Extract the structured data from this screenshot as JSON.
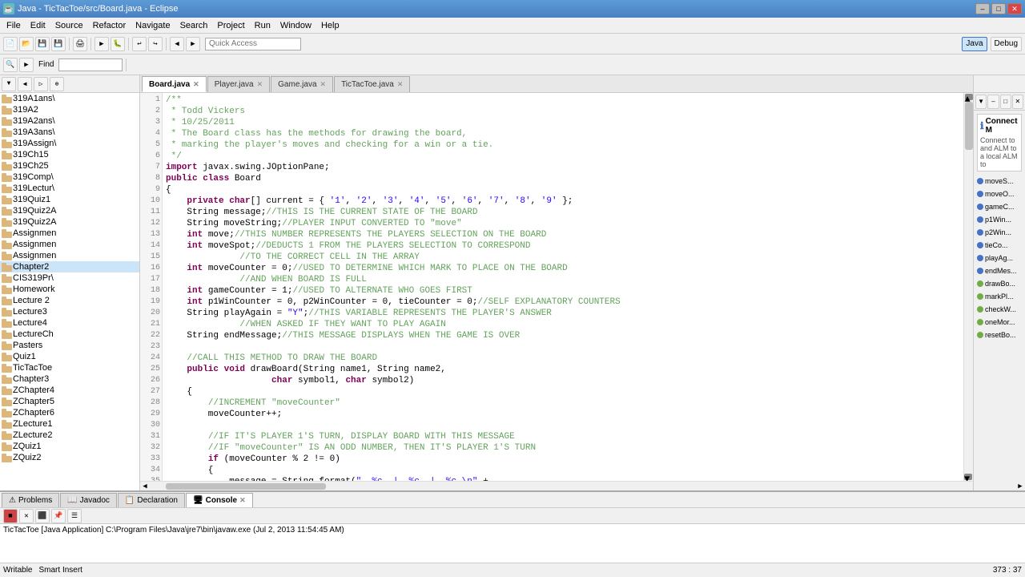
{
  "window": {
    "title": "Java - TicTacToe/src/Board.java - Eclipse",
    "icon": "☕"
  },
  "title_bar_buttons": {
    "minimize": "–",
    "maximize": "□",
    "close": "✕"
  },
  "menu": {
    "items": [
      "File",
      "Edit",
      "Source",
      "Refactor",
      "Navigate",
      "Search",
      "Project",
      "Run",
      "Window",
      "Help"
    ]
  },
  "toolbar": {
    "quick_access_placeholder": "Quick Access",
    "perspective_java": "Java",
    "perspective_debug": "Debug"
  },
  "editor_tabs": [
    {
      "label": "Board.java",
      "active": true
    },
    {
      "label": "Player.java",
      "active": false
    },
    {
      "label": "Game.java",
      "active": false
    },
    {
      "label": "TicTacToe.java",
      "active": false
    }
  ],
  "code": {
    "author": "Todd Vickers",
    "date": "10/25/2011",
    "comment1": "* The Board class has the methods for drawing the board,",
    "comment2": "* marking the player's moves and checking for a win or a tie.",
    "comment3": "*/",
    "import1": "import javax.swing.JOptionPane;",
    "class_decl": "public class Board",
    "lines": [
      "/**",
      " * Todd Vickers",
      " * 10/25/2011",
      " * The Board class has the methods for drawing the board,",
      " * marking the player's moves and checking for a win or a tie.",
      " */",
      "import javax.swing.JOptionPane;",
      "public class Board",
      "{",
      "    private char[] current = { '1', '2', '3', '4', '5', '6', '7', '8', '9' };",
      "    String message;//THIS IS THE CURRENT STATE OF THE BOARD",
      "    String moveString;//PLAYER INPUT CONVERTED TO \"move\"",
      "    int move;//THIS NUMBER REPRESENTS THE PLAYERS SELECTION ON THE BOARD",
      "    int moveSpot;//DEDUCTS 1 FROM THE PLAYERS SELECTION TO CORRESPOND",
      "                  //TO THE CORRECT CELL IN THE ARRAY",
      "    int moveCounter = 0;//USED TO DETERMINE WHICH MARK TO PLACE ON THE BOARD",
      "                  //AND WHEN BOARD IS FULL",
      "    int gameCounter = 1;//USED TO ALTERNATE WHO GOES FIRST",
      "    int p1WinCounter = 0, p2WinCounter = 0, tieCounter = 0;//SELF EXPLANATORY COUNTERS",
      "    String playAgain = \"Y\";//THIS VARIABLE REPRESENTS THE PLAYER'S ANSWER",
      "                  //WHEN ASKED IF THEY WANT TO PLAY AGAIN",
      "    String endMessage;//THIS MESSAGE DISPLAYS WHEN THE GAME IS OVER",
      "    ",
      "    //CALL THIS METHOD TO DRAW THE BOARD",
      "    public void drawBoard(String name1, String name2,",
      "                    char symbol1, char symbol2)",
      "    {",
      "        //INCREMENT \"moveCounter\"",
      "        moveCounter++;",
      "        ",
      "        //IF IT'S PLAYER 1'S TURN, DISPLAY BOARD WITH THIS MESSAGE",
      "        //IF \"moveCounter\" IS AN ODD NUMBER, THEN IT'S PLAYER 1'S TURN",
      "        if (moveCounter % 2 != 0)",
      "        {",
      "            message = String.format(\"  %c  |  %c  |  %c \\n\" +"
    ]
  },
  "sidebar": {
    "toolbar_items": [
      "▼",
      "◀",
      "▷",
      "⊕"
    ],
    "tree_items": [
      {
        "label": "319A1ans\\",
        "indent": 0,
        "type": "folder"
      },
      {
        "label": "319A2",
        "indent": 0,
        "type": "folder"
      },
      {
        "label": "319A2ans\\",
        "indent": 0,
        "type": "folder"
      },
      {
        "label": "319A3ans\\",
        "indent": 0,
        "type": "folder"
      },
      {
        "label": "319Assign\\",
        "indent": 0,
        "type": "folder"
      },
      {
        "label": "319Ch15",
        "indent": 0,
        "type": "folder"
      },
      {
        "label": "319Ch25",
        "indent": 0,
        "type": "folder"
      },
      {
        "label": "319Comp\\",
        "indent": 0,
        "type": "folder"
      },
      {
        "label": "319Lectur\\",
        "indent": 0,
        "type": "folder"
      },
      {
        "label": "319Quiz1",
        "indent": 0,
        "type": "folder"
      },
      {
        "label": "319Quiz2A",
        "indent": 0,
        "type": "folder"
      },
      {
        "label": "319Quiz2A",
        "indent": 0,
        "type": "folder"
      },
      {
        "label": "Assignmen",
        "indent": 0,
        "type": "folder"
      },
      {
        "label": "Assignmen",
        "indent": 0,
        "type": "folder"
      },
      {
        "label": "Assignmen",
        "indent": 0,
        "type": "folder"
      },
      {
        "label": "Chapter2",
        "indent": 0,
        "type": "folder",
        "selected": true
      },
      {
        "label": "CIS319Pr\\",
        "indent": 0,
        "type": "folder"
      },
      {
        "label": "Homework",
        "indent": 0,
        "type": "folder"
      },
      {
        "label": "Lecture 2",
        "indent": 0,
        "type": "folder"
      },
      {
        "label": "Lecture3",
        "indent": 0,
        "type": "folder"
      },
      {
        "label": "Lecture4",
        "indent": 0,
        "type": "folder"
      },
      {
        "label": "LectureCh",
        "indent": 0,
        "type": "folder"
      },
      {
        "label": "Pasters",
        "indent": 0,
        "type": "folder"
      },
      {
        "label": "Quiz1",
        "indent": 0,
        "type": "folder"
      },
      {
        "label": "TicTacToe",
        "indent": 0,
        "type": "folder"
      },
      {
        "label": "Chapter3",
        "indent": 0,
        "type": "folder"
      },
      {
        "label": "ZChapter4",
        "indent": 0,
        "type": "folder"
      },
      {
        "label": "ZChapter5",
        "indent": 0,
        "type": "folder"
      },
      {
        "label": "ZChapter6",
        "indent": 0,
        "type": "folder"
      },
      {
        "label": "ZLecture1",
        "indent": 0,
        "type": "folder"
      },
      {
        "label": "ZLecture2",
        "indent": 0,
        "type": "folder"
      },
      {
        "label": "ZQuiz1",
        "indent": 0,
        "type": "folder"
      },
      {
        "label": "ZQuiz2",
        "indent": 0,
        "type": "folder"
      }
    ]
  },
  "right_sidebar": {
    "outline_items": [
      {
        "label": "moveS...",
        "type": "field"
      },
      {
        "label": "moveO...",
        "type": "field"
      },
      {
        "label": "gameC...",
        "type": "field"
      },
      {
        "label": "p1Win...",
        "type": "field"
      },
      {
        "label": "p2Win...",
        "type": "field"
      },
      {
        "label": "tieCo...",
        "type": "field"
      },
      {
        "label": "playAg...",
        "type": "field"
      },
      {
        "label": "endMes...",
        "type": "field"
      },
      {
        "label": "drawBo...",
        "type": "method"
      },
      {
        "label": "markPl...",
        "type": "method"
      },
      {
        "label": "checkW...",
        "type": "method"
      },
      {
        "label": "oneMor...",
        "type": "method"
      },
      {
        "label": "resetBo...",
        "type": "method"
      }
    ],
    "connect_label": "Connect M",
    "connect_text1": "Connect to",
    "connect_text2": "and ALM to",
    "connect_text3": "a local ALM to"
  },
  "bottom_tabs": [
    "Problems",
    "Javadoc",
    "Declaration",
    "Console"
  ],
  "bottom_toolbar_btns": [
    "■",
    "✕",
    "⊡",
    "⊠",
    "⬛",
    "▤",
    "☰"
  ],
  "console_text": "TicTacToe [Java Application] C:\\Program Files\\Java\\jre7\\bin\\javaw.exe (Jul 2, 2013 11:54:45 AM)",
  "status_bar": {
    "left_text": "Writable",
    "middle_text": "Smart Insert",
    "right_text": "373 : 37"
  }
}
